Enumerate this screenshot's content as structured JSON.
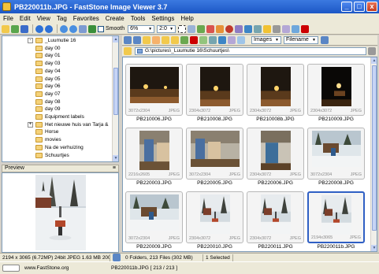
{
  "window": {
    "title": "PB220011b.JPG - FastStone Image Viewer 3.7",
    "minimize": "_",
    "maximize": "□",
    "close": "x"
  },
  "menu": [
    "File",
    "Edit",
    "View",
    "Tag",
    "Favorites",
    "Create",
    "Tools",
    "Settings",
    "Help"
  ],
  "toolbar": {
    "smooth_label": "Smooth",
    "zoom_value": "6%",
    "ratio_value": "2:0"
  },
  "browser_toolbar": {
    "filter_value": "Images",
    "sort_value": "Filename"
  },
  "path": "G:\\pictures\\_Luumutie 16\\Schuurtjes\\",
  "folder_tree": [
    {
      "label": "_Luumutie 16",
      "level": 0,
      "expander": "-"
    },
    {
      "label": "day 00",
      "level": 1,
      "expander": ""
    },
    {
      "label": "day 01",
      "level": 1,
      "expander": ""
    },
    {
      "label": "day 03",
      "level": 1,
      "expander": ""
    },
    {
      "label": "day 04",
      "level": 1,
      "expander": ""
    },
    {
      "label": "day 05",
      "level": 1,
      "expander": ""
    },
    {
      "label": "day 06",
      "level": 1,
      "expander": ""
    },
    {
      "label": "day 07",
      "level": 1,
      "expander": ""
    },
    {
      "label": "day 08",
      "level": 1,
      "expander": ""
    },
    {
      "label": "day 09",
      "level": 1,
      "expander": ""
    },
    {
      "label": "Equipment labels",
      "level": 1,
      "expander": ""
    },
    {
      "label": "Het nieuwe huis van Tarja & ",
      "level": 1,
      "expander": "+"
    },
    {
      "label": "Horse",
      "level": 1,
      "expander": ""
    },
    {
      "label": "movies",
      "level": 1,
      "expander": ""
    },
    {
      "label": "Na de verhuizing",
      "level": 1,
      "expander": ""
    },
    {
      "label": "Schuurtjes",
      "level": 1,
      "expander": ""
    }
  ],
  "preview": {
    "title": "Preview",
    "collapse_icon": "≡"
  },
  "thumbnails": [
    {
      "name": "PB210006.JPG",
      "dims": "3072x2304",
      "type": "JPEG",
      "scene": "night",
      "selected": false
    },
    {
      "name": "PB210008.JPG",
      "dims": "2304x3072",
      "type": "JPEG",
      "scene": "night",
      "selected": false
    },
    {
      "name": "PB210008b.JPG",
      "dims": "2304x3072",
      "type": "JPEG",
      "scene": "night",
      "selected": false
    },
    {
      "name": "PB210009.JPG",
      "dims": "2304x3072",
      "type": "JPEG",
      "scene": "night-dark",
      "selected": false
    },
    {
      "name": "PB220003.JPG",
      "dims": "2216x2605",
      "type": "JPEG",
      "scene": "shed",
      "selected": false
    },
    {
      "name": "PB220005.JPG",
      "dims": "3072x2304",
      "type": "JPEG",
      "scene": "shed",
      "selected": false
    },
    {
      "name": "PB220006.JPG",
      "dims": "2304x3072",
      "type": "JPEG",
      "scene": "shed-portrait",
      "selected": false
    },
    {
      "name": "PB220008.JPG",
      "dims": "3072x2304",
      "type": "JPEG",
      "scene": "snow",
      "selected": false
    },
    {
      "name": "PB220009.JPG",
      "dims": "3072x2304",
      "type": "JPEG",
      "scene": "snow",
      "selected": false
    },
    {
      "name": "PB220010.JPG",
      "dims": "2304x3072",
      "type": "JPEG",
      "scene": "snow-portrait",
      "selected": false
    },
    {
      "name": "PB220011.JPG",
      "dims": "2304x3072",
      "type": "JPEG",
      "scene": "snow-portrait",
      "selected": false
    },
    {
      "name": "PB220011b.JPG",
      "dims": "2194x3065",
      "type": "JPEG",
      "scene": "snow-portrait",
      "selected": true
    }
  ],
  "status": {
    "image_info": "2194 x 3065 (6.72MP)  24bit JPEG  1.63 MB  2005-",
    "folder_info": "0 Folders, 213 Files (302 MB)",
    "selection": "1 Selected"
  },
  "bottom": {
    "website": "www.FastStone.org",
    "file_position": "PB220011b.JPG [ 213 / 213 ]"
  },
  "colors": {
    "title_blue": "#1c57c6",
    "selected_border": "#2f5fc4",
    "chrome": "#ece9d8"
  }
}
